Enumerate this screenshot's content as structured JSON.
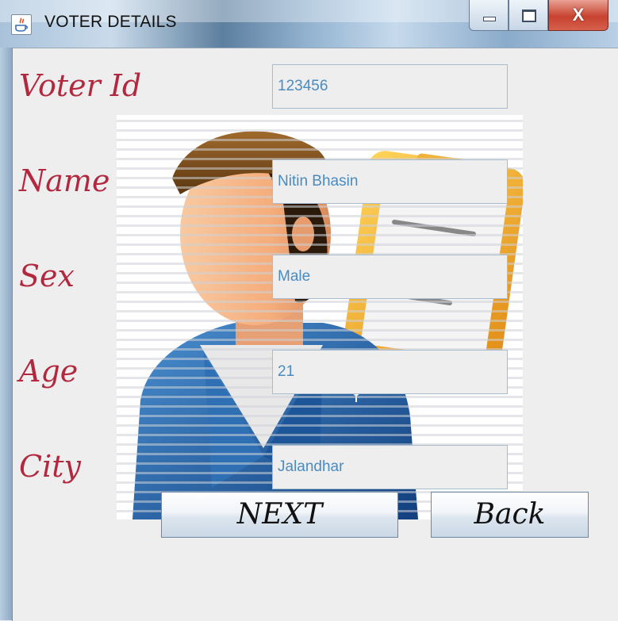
{
  "window": {
    "title": "VOTER DETAILS",
    "icon": "java-app-icon",
    "controls": {
      "minimize": "minimize-icon",
      "maximize": "maximize-icon",
      "close_glyph": "X"
    }
  },
  "form": {
    "fields": [
      {
        "label": "Voter Id",
        "value": "123456"
      },
      {
        "label": "Name",
        "value": "Nitin Bhasin"
      },
      {
        "label": "Sex",
        "value": "Male"
      },
      {
        "label": "Age",
        "value": "21"
      },
      {
        "label": "City",
        "value": "Jalandhar"
      }
    ]
  },
  "buttons": {
    "next": "NEXT",
    "back": "Back"
  },
  "colors": {
    "label": "#b2283f",
    "field_text": "#4a8bc0",
    "field_border": "#a8bcd1",
    "background": "#eeeeee"
  }
}
